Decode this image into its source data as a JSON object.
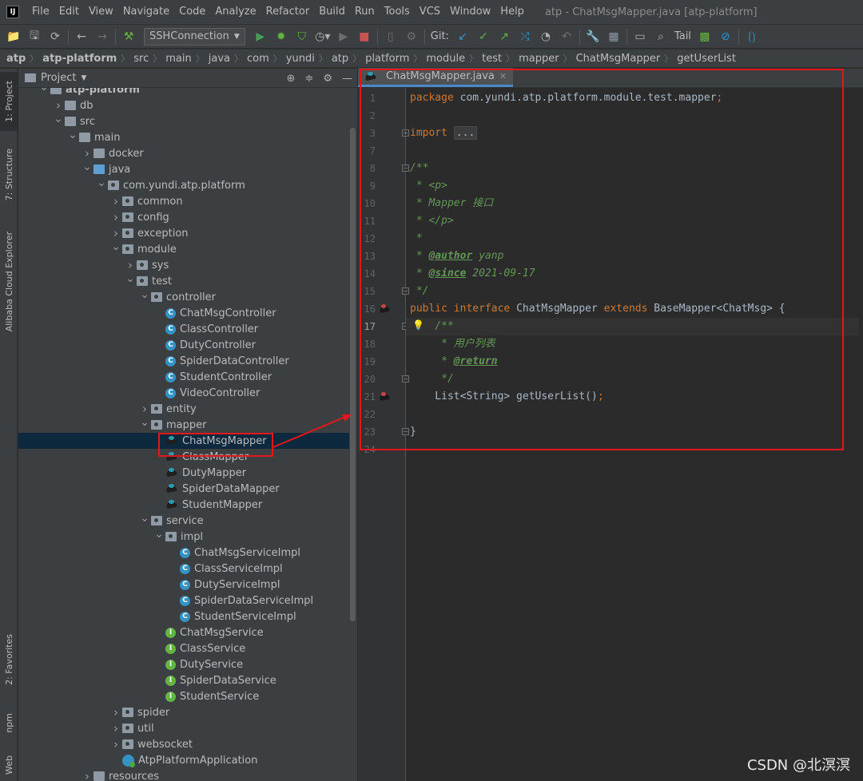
{
  "menubar": {
    "logo": "IJ",
    "items": [
      "File",
      "Edit",
      "View",
      "Navigate",
      "Code",
      "Analyze",
      "Refactor",
      "Build",
      "Run",
      "Tools",
      "VCS",
      "Window",
      "Help"
    ],
    "window_title": "atp - ChatMsgMapper.java [atp-platform]"
  },
  "toolbar": {
    "run_config": "SSHConnection",
    "git_label": "Git:",
    "tail_label": "Tail"
  },
  "breadcrumb": [
    "atp",
    "atp-platform",
    "src",
    "main",
    "java",
    "com",
    "yundi",
    "atp",
    "platform",
    "module",
    "test",
    "mapper",
    "ChatMsgMapper",
    "getUserList"
  ],
  "tool_strip": {
    "project": "1: Project",
    "structure": "7: Structure",
    "alibaba": "Alibaba Cloud Explorer",
    "favorites": "2: Favorites",
    "npm": "npm",
    "web": "Web"
  },
  "project_panel": {
    "title": "Project",
    "tree": [
      {
        "label": "atp-platform",
        "icon": "folder",
        "indent": 0,
        "arrow": "down",
        "bold": true
      },
      {
        "label": "db",
        "icon": "folder",
        "indent": 1,
        "arrow": "right"
      },
      {
        "label": "src",
        "icon": "folder",
        "indent": 1,
        "arrow": "down"
      },
      {
        "label": "main",
        "icon": "folder",
        "indent": 2,
        "arrow": "down"
      },
      {
        "label": "docker",
        "icon": "folder",
        "indent": 3,
        "arrow": "right"
      },
      {
        "label": "java",
        "icon": "folder-blue",
        "indent": 3,
        "arrow": "down"
      },
      {
        "label": "com.yundi.atp.platform",
        "icon": "package",
        "indent": 4,
        "arrow": "down"
      },
      {
        "label": "common",
        "icon": "package",
        "indent": 5,
        "arrow": "right"
      },
      {
        "label": "config",
        "icon": "package",
        "indent": 5,
        "arrow": "right"
      },
      {
        "label": "exception",
        "icon": "package",
        "indent": 5,
        "arrow": "right"
      },
      {
        "label": "module",
        "icon": "package",
        "indent": 5,
        "arrow": "down"
      },
      {
        "label": "sys",
        "icon": "package",
        "indent": 6,
        "arrow": "right"
      },
      {
        "label": "test",
        "icon": "package",
        "indent": 6,
        "arrow": "down"
      },
      {
        "label": "controller",
        "icon": "package",
        "indent": 7,
        "arrow": "down"
      },
      {
        "label": "ChatMsgController",
        "icon": "class",
        "indent": 8
      },
      {
        "label": "ClassController",
        "icon": "class",
        "indent": 8
      },
      {
        "label": "DutyController",
        "icon": "class",
        "indent": 8
      },
      {
        "label": "SpiderDataController",
        "icon": "class",
        "indent": 8
      },
      {
        "label": "StudentController",
        "icon": "class",
        "indent": 8
      },
      {
        "label": "VideoController",
        "icon": "class",
        "indent": 8
      },
      {
        "label": "entity",
        "icon": "package",
        "indent": 7,
        "arrow": "right"
      },
      {
        "label": "mapper",
        "icon": "package",
        "indent": 7,
        "arrow": "down"
      },
      {
        "label": "ChatMsgMapper",
        "icon": "mapper",
        "indent": 8,
        "selected": true
      },
      {
        "label": "ClassMapper",
        "icon": "mapper",
        "indent": 8
      },
      {
        "label": "DutyMapper",
        "icon": "mapper",
        "indent": 8
      },
      {
        "label": "SpiderDataMapper",
        "icon": "mapper",
        "indent": 8
      },
      {
        "label": "StudentMapper",
        "icon": "mapper",
        "indent": 8
      },
      {
        "label": "service",
        "icon": "package",
        "indent": 7,
        "arrow": "down"
      },
      {
        "label": "impl",
        "icon": "package",
        "indent": 8,
        "arrow": "down"
      },
      {
        "label": "ChatMsgServiceImpl",
        "icon": "class",
        "indent": 9
      },
      {
        "label": "ClassServiceImpl",
        "icon": "class",
        "indent": 9
      },
      {
        "label": "DutyServiceImpl",
        "icon": "class",
        "indent": 9
      },
      {
        "label": "SpiderDataServiceImpl",
        "icon": "class",
        "indent": 9
      },
      {
        "label": "StudentServiceImpl",
        "icon": "class",
        "indent": 9
      },
      {
        "label": "ChatMsgService",
        "icon": "interface",
        "indent": 8
      },
      {
        "label": "ClassService",
        "icon": "interface",
        "indent": 8
      },
      {
        "label": "DutyService",
        "icon": "interface",
        "indent": 8
      },
      {
        "label": "SpiderDataService",
        "icon": "interface",
        "indent": 8
      },
      {
        "label": "StudentService",
        "icon": "interface",
        "indent": 8
      },
      {
        "label": "spider",
        "icon": "package",
        "indent": 5,
        "arrow": "right"
      },
      {
        "label": "util",
        "icon": "package",
        "indent": 5,
        "arrow": "right"
      },
      {
        "label": "websocket",
        "icon": "package",
        "indent": 5,
        "arrow": "right"
      },
      {
        "label": "AtpPlatformApplication",
        "icon": "app",
        "indent": 5
      },
      {
        "label": "resources",
        "icon": "folder",
        "indent": 3,
        "arrow": "right"
      }
    ]
  },
  "editor": {
    "tab_label": "ChatMsgMapper.java",
    "current_line": 17,
    "lines": [
      {
        "n": "1",
        "parts": [
          {
            "t": "package ",
            "c": "kw"
          },
          {
            "t": "com.yundi.atp.platform.module.test.mapper",
            "c": ""
          },
          {
            "t": ";",
            "c": "kw"
          }
        ]
      },
      {
        "n": "2",
        "parts": []
      },
      {
        "n": "3",
        "fold": "+",
        "parts": [
          {
            "t": "import ",
            "c": "kw"
          },
          {
            "t": "...",
            "c": "fold-text"
          }
        ]
      },
      {
        "n": "7",
        "parts": []
      },
      {
        "n": "8",
        "fold": "-",
        "parts": [
          {
            "t": "/**",
            "c": "cm"
          }
        ]
      },
      {
        "n": "9",
        "parts": [
          {
            "t": " * ",
            "c": "cm"
          },
          {
            "t": "<p>",
            "c": "cm"
          }
        ]
      },
      {
        "n": "10",
        "parts": [
          {
            "t": " * Mapper 接口",
            "c": "cm"
          }
        ]
      },
      {
        "n": "11",
        "parts": [
          {
            "t": " * ",
            "c": "cm"
          },
          {
            "t": "</p>",
            "c": "cm"
          }
        ]
      },
      {
        "n": "12",
        "parts": [
          {
            "t": " *",
            "c": "cm"
          }
        ]
      },
      {
        "n": "13",
        "parts": [
          {
            "t": " * ",
            "c": "cm"
          },
          {
            "t": "@author",
            "c": "tag"
          },
          {
            "t": " yanp",
            "c": "cm"
          }
        ]
      },
      {
        "n": "14",
        "parts": [
          {
            "t": " * ",
            "c": "cm"
          },
          {
            "t": "@since",
            "c": "tag"
          },
          {
            "t": " 2021-09-17",
            "c": "cm"
          }
        ]
      },
      {
        "n": "15",
        "fold": "-",
        "parts": [
          {
            "t": " */",
            "c": "cm"
          }
        ]
      },
      {
        "n": "16",
        "mark": true,
        "parts": [
          {
            "t": "public interface ",
            "c": "kw"
          },
          {
            "t": "ChatMsgMapper ",
            "c": ""
          },
          {
            "t": "extends ",
            "c": "kw"
          },
          {
            "t": "BaseMapper<ChatMsg> {",
            "c": ""
          }
        ]
      },
      {
        "n": "17",
        "fold": "-",
        "bulb": true,
        "parts": [
          {
            "t": "    /**",
            "c": "cm"
          }
        ]
      },
      {
        "n": "18",
        "parts": [
          {
            "t": "     * 用户列表",
            "c": "cm"
          }
        ]
      },
      {
        "n": "19",
        "parts": [
          {
            "t": "     * ",
            "c": "cm"
          },
          {
            "t": "@return",
            "c": "tag"
          }
        ]
      },
      {
        "n": "20",
        "fold": "-",
        "parts": [
          {
            "t": "     */",
            "c": "cm"
          }
        ]
      },
      {
        "n": "21",
        "mark": true,
        "parts": [
          {
            "t": "    List<String> getUserList()",
            "c": ""
          },
          {
            "t": ";",
            "c": "kw"
          }
        ]
      },
      {
        "n": "22",
        "parts": []
      },
      {
        "n": "23",
        "fold": "-",
        "parts": [
          {
            "t": "}",
            "c": ""
          }
        ]
      },
      {
        "n": "24",
        "parts": []
      }
    ]
  },
  "watermark": "CSDN @北溟溟",
  "colors": {
    "highlight": "#e3161b",
    "selection": "#0d293e",
    "keyword": "#cc7832",
    "comment": "#629755"
  }
}
